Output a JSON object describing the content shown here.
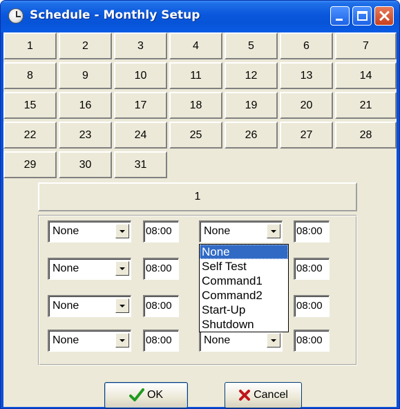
{
  "window": {
    "title": "Schedule - Monthly Setup"
  },
  "days": [
    "1",
    "2",
    "3",
    "4",
    "5",
    "6",
    "7",
    "8",
    "9",
    "10",
    "11",
    "12",
    "13",
    "14",
    "15",
    "16",
    "17",
    "18",
    "19",
    "20",
    "21",
    "22",
    "23",
    "24",
    "25",
    "26",
    "27",
    "28",
    "29",
    "30",
    "31"
  ],
  "selected_day": "1",
  "rows": [
    {
      "action1": "None",
      "time1": "08:00",
      "action2": "None",
      "time2": "08:00"
    },
    {
      "action1": "None",
      "time1": "08:00",
      "action2": "None",
      "time2": "08:00"
    },
    {
      "action1": "None",
      "time1": "08:00",
      "action2": "None",
      "time2": "08:00"
    },
    {
      "action1": "None",
      "time1": "08:00",
      "action2": "None",
      "time2": "08:00"
    }
  ],
  "dropdown": {
    "options": [
      "None",
      "Self Test",
      "Command1",
      "Command2",
      "Start-Up",
      "Shutdown"
    ],
    "selected": "None"
  },
  "buttons": {
    "ok_label": "OK",
    "cancel_label": "Cancel"
  },
  "colors": {
    "title_bar": "#0a57dc",
    "client_bg": "#ece9d8",
    "selection": "#316ac5",
    "ok_check": "#1f9a1f",
    "cancel_x": "#c0141a"
  }
}
